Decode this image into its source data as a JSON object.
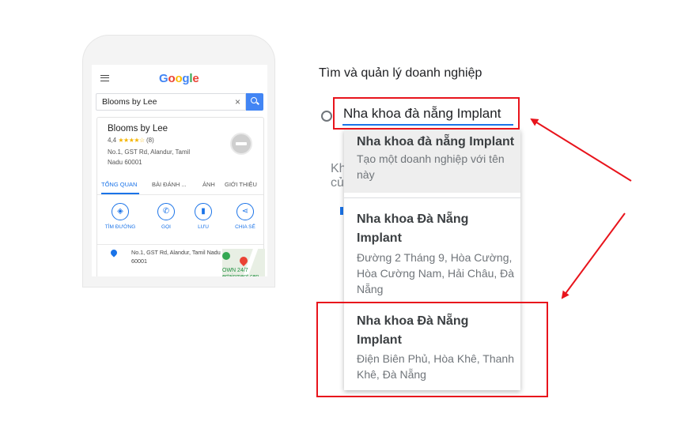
{
  "phone": {
    "logo": [
      "G",
      "o",
      "o",
      "g",
      "l",
      "e"
    ],
    "search_value": "Blooms by Lee",
    "clear_symbol": "×",
    "business": {
      "name": "Blooms by Lee",
      "rating": "4,4",
      "stars": "★★★★☆",
      "review_count": "(8)",
      "address_short": "No.1, GST Rd, Alandur, Tamil Nadu 60001"
    },
    "tabs": [
      "TỔNG QUAN",
      "BÀI ĐÁNH ...",
      "ẢNH",
      "GIỚI THIỆU"
    ],
    "actions": [
      {
        "icon": "directions-icon",
        "glyph": "◈",
        "label": "TÌM ĐƯỜNG"
      },
      {
        "icon": "phone-icon",
        "glyph": "✆",
        "label": "GỌI"
      },
      {
        "icon": "bookmark-icon",
        "glyph": "▮",
        "label": "LƯU"
      },
      {
        "icon": "share-icon",
        "glyph": "⋖",
        "label": "CHIA SẺ"
      }
    ],
    "address_full": "No.1, GST Rd, Alandur, Tamil Nadu 60001",
    "map_label": "OWN 24/7\nertainment cen"
  },
  "form": {
    "heading": "Tìm và quản lý doanh nghiệp",
    "search_value": "Nha khoa đà nẵng Implant",
    "partial_text": "Kh\ncủ"
  },
  "dropdown": {
    "items": [
      {
        "title": "Nha khoa đà nẵng Implant",
        "subtitle": "Tạo một doanh nghiệp với tên này"
      },
      {
        "title": "Nha khoa Đà Nẵng Implant",
        "subtitle": "Đường 2 Tháng 9, Hòa Cường, Hòa Cường Nam, Hải Châu, Đà Nẵng"
      },
      {
        "title": "Nha khoa Đà Nẵng Implant",
        "subtitle": "Điện Biên Phủ, Hòa Khê, Thanh Khê, Đà Nẵng"
      }
    ]
  },
  "colors": {
    "accent": "#1a73e8",
    "annotation_red": "#e8141c",
    "highlight": "#eeeeee"
  }
}
